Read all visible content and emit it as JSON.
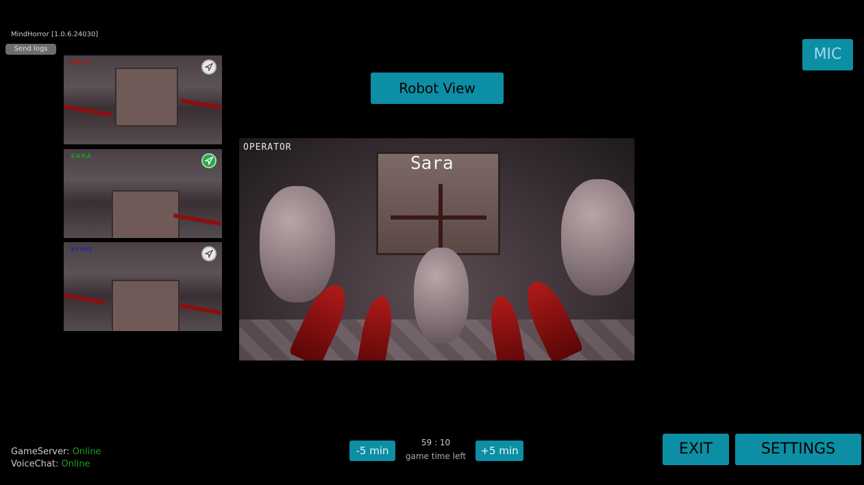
{
  "app": {
    "version_text": "MindHorror [1.0.6.24030]",
    "send_logs_label": "Send logs"
  },
  "mic_label": "MIC",
  "robot_view_label": "Robot View",
  "cameras": [
    {
      "label": "Dana",
      "label_color": "#b01818"
    },
    {
      "label": "SARA",
      "label_color": "#1e9a1e"
    },
    {
      "label": "Scott",
      "label_color": "#1a2aa8"
    }
  ],
  "main_view": {
    "corner_label": "OPERATOR",
    "player_name": "Sara"
  },
  "status": {
    "game_server_label": "GameServer:",
    "game_server_value": "Online",
    "voice_chat_label": "VoiceChat:",
    "voice_chat_value": "Online"
  },
  "timer": {
    "minus_label": "-5 min",
    "plus_label": "+5 min",
    "time": "59 : 10",
    "caption": "game time left"
  },
  "buttons": {
    "exit_label": "EXIT",
    "settings_label": "SETTINGS"
  },
  "colors": {
    "accent": "#0c8ea4",
    "online": "#1fa01f",
    "active_locate": "#2aa84a"
  },
  "icons": {
    "locate": "navigation-arrow-icon"
  }
}
